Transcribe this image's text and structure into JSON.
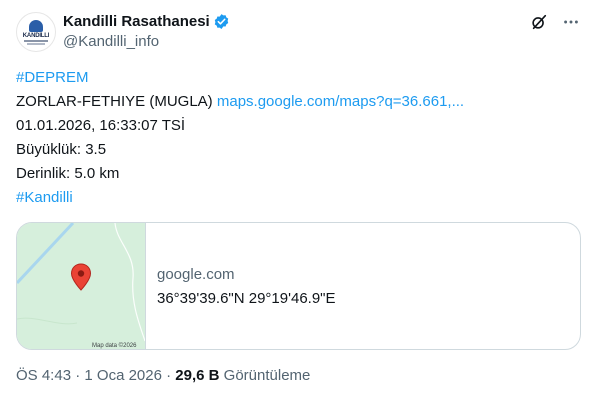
{
  "author": {
    "display_name": "Kandilli Rasathanesi",
    "handle": "@Kandilli_info",
    "avatar_text": "KANDILLI"
  },
  "tweet": {
    "hashtag_top": "#DEPREM",
    "location": "ZORLAR-FETHIYE (MUGLA)",
    "map_link": "maps.google.com/maps?q=36.661,...",
    "datetime": "01.01.2026, 16:33:07 TSİ",
    "magnitude": "Büyüklük: 3.5",
    "depth": "Derinlik: 5.0 km",
    "hashtag_bottom": "#Kandilli"
  },
  "card": {
    "domain": "google.com",
    "coordinates": "36°39'39.6\"N 29°19'46.9\"E",
    "map_credit": "Map data ©2026"
  },
  "meta": {
    "time": "ÖS 4:43",
    "separator": "·",
    "date": "1 Oca 2026",
    "views_count": "29,6 B",
    "views_label": "Görüntüleme"
  },
  "colors": {
    "link": "#1d9bf0",
    "verified": "#1d9bf0",
    "secondary_text": "#536471",
    "map_land": "#d6efdc",
    "map_pin": "#ea4335"
  },
  "icons": {
    "verified": "verified-badge-icon",
    "grok": "grok-icon",
    "more": "more-icon",
    "pin": "map-pin-icon"
  }
}
